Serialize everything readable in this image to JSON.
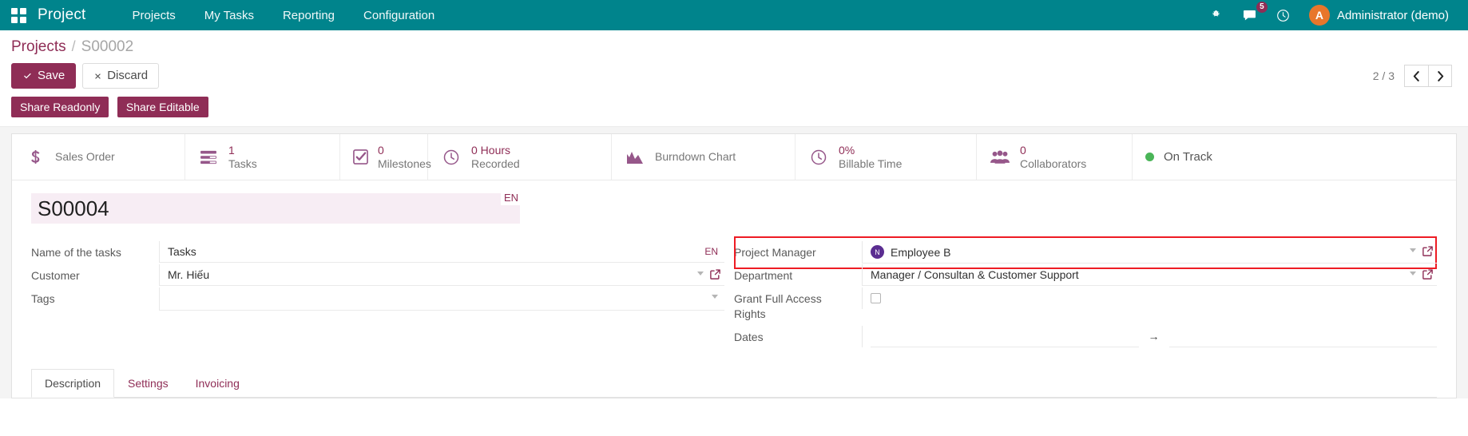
{
  "navbar": {
    "apps_icon": "apps-grid-icon",
    "brand": "Project",
    "menus": [
      {
        "label": "Projects"
      },
      {
        "label": "My Tasks"
      },
      {
        "label": "Reporting"
      },
      {
        "label": "Configuration"
      }
    ],
    "bug_icon": "bug-icon",
    "messages_icon": "chat-bubble-icon",
    "messages_count": "5",
    "activity_icon": "clock-icon",
    "avatar_initial": "A",
    "user_name": "Administrator (demo)"
  },
  "control_panel": {
    "breadcrumb_root": "Projects",
    "breadcrumb_separator": "/",
    "breadcrumb_current": "S00002",
    "save_label": "Save",
    "save_icon": "check-icon",
    "discard_label": "Discard",
    "discard_icon": "close-icon",
    "pager_value": "2 / 3",
    "prev_icon": "chevron-left-icon",
    "next_icon": "chevron-right-icon"
  },
  "share_buttons": [
    {
      "label": "Share Readonly"
    },
    {
      "label": "Share Editable"
    }
  ],
  "stat_buttons": [
    {
      "icon": "dollar-icon",
      "value": "",
      "label": "Sales Order",
      "single": true
    },
    {
      "icon": "list-icon",
      "value": "1",
      "label": "Tasks",
      "single": false
    },
    {
      "icon": "check-square-icon",
      "value": "0",
      "label": "Milestones",
      "single": false
    },
    {
      "icon": "clock-icon",
      "value": "0 Hours",
      "label": "Recorded",
      "single": false
    },
    {
      "icon": "area-chart-icon",
      "value": "",
      "label": "Burndown Chart",
      "single": true
    },
    {
      "icon": "clock-icon",
      "value": "0%",
      "label": "Billable Time",
      "single": false
    },
    {
      "icon": "users-icon",
      "value": "0",
      "label": "Collaborators",
      "single": false
    },
    {
      "icon": "status-dot-icon",
      "value": "",
      "label": "On Track",
      "single": true
    }
  ],
  "status_color": "#4ab558",
  "form": {
    "title_value": "S00004",
    "title_lang_badge": "EN",
    "left_fields": [
      {
        "label": "Name of the tasks",
        "value": "Tasks",
        "lang_badge": "EN",
        "has_caret": false,
        "has_external": false
      },
      {
        "label": "Customer",
        "value": "Mr. Hiếu",
        "lang_badge": "",
        "has_caret": true,
        "has_external": true
      },
      {
        "label": "Tags",
        "value": "",
        "lang_badge": "",
        "has_caret": true,
        "has_external": false
      }
    ],
    "right_fields": {
      "project_manager": {
        "label": "Project Manager",
        "avatar_initial": "N",
        "value": "Employee B",
        "highlighted": true,
        "highlight_color": "#ee1c24"
      },
      "department": {
        "label": "Department",
        "value": "Manager / Consultan & Customer Support"
      },
      "grant_full_access": {
        "label": "Grant Full Access Rights",
        "checked": false
      },
      "dates": {
        "label": "Dates",
        "start_value": "",
        "end_value": "",
        "arrow": "→"
      }
    }
  },
  "notebook_tabs": [
    {
      "label": "Description",
      "active": true
    },
    {
      "label": "Settings",
      "active": false
    },
    {
      "label": "Invoicing",
      "active": false
    }
  ],
  "colors": {
    "navbar": "#00848c",
    "primary": "#8f2d56",
    "accent_purple": "#5b2d91",
    "highlight": "#ee1c24"
  }
}
